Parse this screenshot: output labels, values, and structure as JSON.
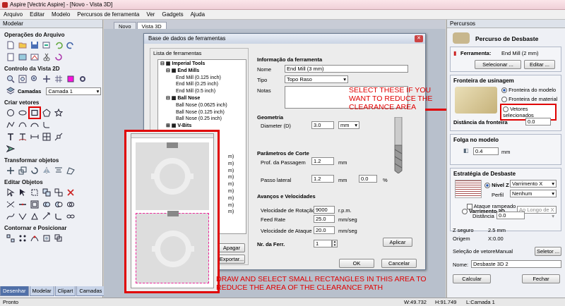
{
  "window": {
    "title": "Aspire [Vectric Aspire] - [Novo - Vista 3D]"
  },
  "menu": [
    "Arquivo",
    "Editar",
    "Modelo",
    "Percursos de ferramenta",
    "Ver",
    "Gadgets",
    "Ajuda"
  ],
  "left_panel": {
    "header": "Modelar",
    "sections": {
      "file_ops": "Operações do Arquivo",
      "view2d": "Controlo da Vista 2D",
      "create_vectors": "Criar vetores",
      "transform": "Transformar objetos",
      "edit": "Editar Objetos",
      "contour": "Contornar e Posicionar"
    },
    "layers_label": "Camadas",
    "layer_value": "Camada 1",
    "tabs": [
      "Desenhar",
      "Modelar",
      "Clipart",
      "Camadas"
    ]
  },
  "center": {
    "tabs": [
      "Novo",
      "Vista 3D"
    ]
  },
  "dialog": {
    "title": "Base de dados de ferramentas",
    "list_title": "Lista de ferramentas",
    "tree": {
      "root": "Imperial Tools",
      "groups": [
        {
          "name": "End Mills",
          "items": [
            "End Mill (0.125 inch)",
            "End Mill (0.25 inch)",
            "End Mill (0.5 inch)"
          ]
        },
        {
          "name": "Ball Nose",
          "items": [
            "Ball Nose (0.0625 inch)",
            "Ball Nose (0.125 inch)",
            "Ball Nose (0.25 inch)"
          ]
        },
        {
          "name": "V-Bits",
          "items": []
        }
      ],
      "partial_m": [
        "m)",
        "m)",
        "m)",
        "m)",
        "m)",
        "m)",
        "m)",
        "m)",
        "m)"
      ]
    },
    "info_title": "Informação da ferramenta",
    "name_label": "Nome",
    "name_value": "End Mill (3 mm)",
    "type_label": "Tipo",
    "type_value": "Topo Raso",
    "notes_label": "Notas",
    "geometry_title": "Geometria",
    "diameter_label": "Diameter (D)",
    "diameter_value": "3.0",
    "diameter_unit": "mm",
    "cut_title": "Parâmetros de Corte",
    "pass_depth_label": "Prof. da Passagem",
    "pass_depth_value": "1.2",
    "pass_depth_unit": "mm",
    "stepover_label": "Passo lateral",
    "stepover_value": "1.2",
    "stepover_unit": "mm",
    "stepover_pct": "0.0",
    "stepover_pct_unit": "%",
    "feeds_title": "Avanços e Velocidades",
    "spindle_label": "Velocidade de Rotação",
    "spindle_value": "9000",
    "spindle_unit": "r.p.m.",
    "feed_label": "Feed Rate",
    "feed_value": "25.0",
    "feed_unit": "mm/seg",
    "plunge_label": "Velocidade de Ataque",
    "plunge_value": "20.0",
    "plunge_unit": "mm/seg",
    "tool_no_label": "Nr. da Ferr.",
    "tool_no_value": "1",
    "apply_button": "Aplicar",
    "delete_button": "Apagar",
    "export_button": "Exportar...",
    "ok_button": "OK",
    "cancel_button": "Cancelar"
  },
  "annotations": {
    "top": "SELECT THESE IF YOU\nWANT TO REDUCE THE\nCLEARANCE AREA",
    "bottom": "DRAW AND SELECT SMALL RECTANGLES IN THIS AREA TO\nREDUCE THE AREA OF THE CLEARANCE PATH"
  },
  "right_panel": {
    "header": "Percursos",
    "title": "Percurso de Desbaste",
    "tool_label": "Ferramenta:",
    "tool_value": "End Mill (2 mm)",
    "select_button": "Selecionar ...",
    "edit_button": "Editar ...",
    "boundary_title": "Fronteira de usinagem",
    "boundary_opts": [
      "Fronteira do modelo",
      "Fronteira de material",
      "Vetores selecionados"
    ],
    "boundary_dist_label": "Distância da fronteira",
    "boundary_dist_value": "0.0",
    "allowance_title": "Folga no modelo",
    "allowance_value": "0.4",
    "allowance_unit": "mm",
    "strategy_title": "Estratégia de Desbaste",
    "level_z": "Nível Z",
    "level_z_mode": "Varrimento X",
    "profile_label": "Perfil",
    "profile_value": "Nenhum",
    "raster3d": "Varrimento 3D",
    "raster3d_mode": "Ao Longo de X",
    "ramp_label": "Ataque rampeado",
    "ramp_dist_label": "Distância",
    "ramp_dist_value": "0.0",
    "safe_z_label": "Z seguro",
    "safe_z_value": "2.5 mm",
    "home_label": "Origem",
    "home_value": "X:0.00",
    "vector_sel_label": "Seleção de vetoreManual",
    "vector_select_button": "Seletor ...",
    "name_label": "Nome:",
    "name_value": "Desbaste 3D 2",
    "calc_button": "Calcular",
    "close_button": "Fechar"
  },
  "status": {
    "left": "Pronto",
    "w": "W:49.732",
    "h": "H:91.749",
    "layer": "L:Camada 1"
  }
}
